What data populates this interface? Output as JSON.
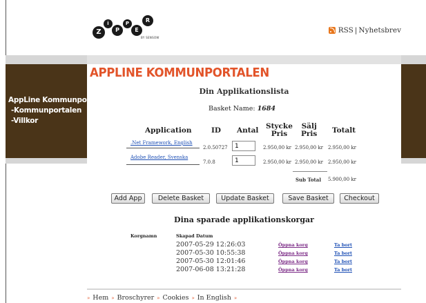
{
  "logo": {
    "letters": [
      "Z",
      "i",
      "P",
      "P",
      "E",
      "R"
    ],
    "tagline": "BY SENSOW"
  },
  "header": {
    "rss_label": "RSS",
    "separator": "|",
    "newsletter_label": "Nyhetsbrev"
  },
  "sidebar": {
    "title": "AppLine Kommunportal",
    "items": [
      {
        "label": "-Kommunportalen"
      },
      {
        "label": "-Villkor"
      }
    ]
  },
  "main": {
    "page_title": "APPLINE KOMMUNPORTALEN",
    "list_title": "Din Applikationslista",
    "basket_label": "Basket Name:",
    "basket_value": "1684",
    "columns": {
      "application": "Application",
      "id": "ID",
      "antal": "Antal",
      "stycke_line1": "Stycke",
      "stycke_line2": "Pris",
      "salj_line1": "Sälj",
      "salj_line2": "Pris",
      "totalt": "Totalt"
    },
    "rows": [
      {
        "app": ".Net Framework, English",
        "id": "2.0.50727",
        "qty": "1",
        "stycke": "2.950,00 kr",
        "salj": "2.950,00 kr",
        "total": "2.950,00 kr"
      },
      {
        "app": "Adobe Reader, Svenska",
        "id": "7.0.8",
        "qty": "1",
        "stycke": "2.950,00 kr",
        "salj": "2.950,00 kr",
        "total": "2.950,00 kr"
      }
    ],
    "subtotal_label": "Sub Total",
    "subtotal_value": "5.900,00 kr",
    "buttons": {
      "add": "Add App",
      "delete": "Delete Basket",
      "update": "Update Basket",
      "save": "Save Basket",
      "checkout": "Checkout"
    },
    "saved": {
      "title": "Dina sparade applikationskorgar",
      "col_korgnamn": "Korgnamn",
      "col_skapad": "Skapad Datum",
      "rows": [
        {
          "date": "2007-05-29 12:26:03",
          "open": "Öppna korg",
          "delete": "Ta bort"
        },
        {
          "date": "2007-05-30 10:55:38",
          "open": "Öppna korg",
          "delete": "Ta bort"
        },
        {
          "date": "2007-05-30 12:01:46",
          "open": "Öppna korg",
          "delete": "Ta bort"
        },
        {
          "date": "2007-06-08 13:21:28",
          "open": "Öppna korg",
          "delete": "Ta bort"
        }
      ]
    }
  },
  "footer": {
    "sep": "»",
    "links": [
      "Hem",
      "Broschyrer",
      "Cookies",
      "In English"
    ]
  },
  "colors": {
    "accent": "#e2542a",
    "sidebar_bg": "#4a3418",
    "link": "#1d4fb5",
    "visited_link": "#7b2a86",
    "rss": "#e8761b"
  }
}
